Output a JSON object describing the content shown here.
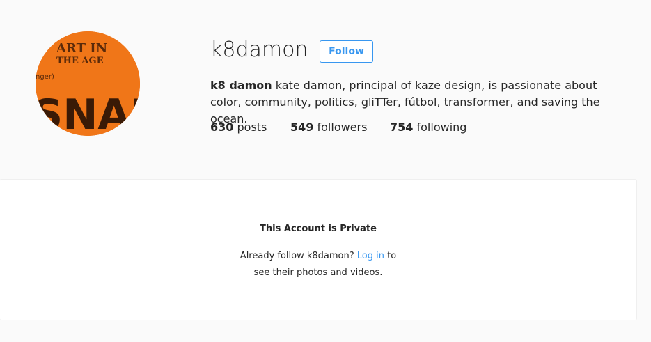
{
  "profile": {
    "username": "k8damon",
    "follow_label": "Follow",
    "full_name": "k8 damon",
    "bio": "kate damon, principal of kaze design, is passionate about color, community, politics, gliTTer, fútbol, transformer, and saving the ocean.",
    "avatar_text_top": "ART IN",
    "avatar_text_mid": "THE AGE",
    "avatar_text_small": "nger)",
    "avatar_text_big": "SNAP"
  },
  "stats": {
    "posts_count": "630",
    "posts_label": "posts",
    "followers_count": "549",
    "followers_label": "followers",
    "following_count": "754",
    "following_label": "following"
  },
  "private": {
    "title": "This Account is Private",
    "msg_before": "Already follow k8damon?",
    "login_label": "Log in",
    "msg_after": "to",
    "msg_line2": "see their photos and videos."
  },
  "colors": {
    "accent": "#3897f0",
    "avatar_orange": "#ef6f12",
    "background": "#fafafa"
  }
}
